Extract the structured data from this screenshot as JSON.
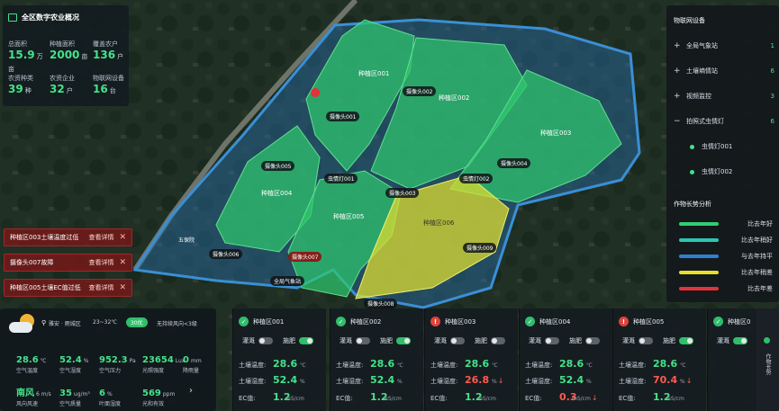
{
  "overview": {
    "title": "全区数字农业概况",
    "stats": [
      {
        "label": "总面积",
        "value": "15.9",
        "unit": "万亩"
      },
      {
        "label": "种植面积",
        "value": "2000",
        "unit": "亩"
      },
      {
        "label": "覆盖农户",
        "value": "136",
        "unit": "户"
      },
      {
        "label": "农资种类",
        "value": "39",
        "unit": "种"
      },
      {
        "label": "农资企业",
        "value": "32",
        "unit": "户"
      },
      {
        "label": "物联网设备",
        "value": "16",
        "unit": "台"
      }
    ]
  },
  "alerts": [
    {
      "text": "种植区003土壤温度过低",
      "action": "查看详情"
    },
    {
      "text": "摄像头007故障",
      "action": "查看详情"
    },
    {
      "text": "种植区005土壤EC值过低",
      "action": "查看详情"
    }
  ],
  "map": {
    "zones": [
      "种植区001",
      "种植区002",
      "种植区003",
      "种植区004",
      "种植区005",
      "种植区006"
    ],
    "devices": [
      "摄像头001",
      "摄像头002",
      "摄像头003",
      "摄像头004",
      "摄像头005",
      "摄像头006",
      "摄像头007",
      "摄像头008",
      "摄像头009",
      "虫情灯001",
      "虫情灯002",
      "全局气象站"
    ],
    "places": [
      "五保院"
    ]
  },
  "iot": {
    "title": "物联网设备",
    "items": [
      {
        "symbol": "+",
        "name": "全局气象站",
        "count": "1"
      },
      {
        "symbol": "+",
        "name": "土壤墒情站",
        "count": "6"
      },
      {
        "symbol": "+",
        "name": "视频监控",
        "count": "3"
      },
      {
        "symbol": "−",
        "name": "拍照式虫情灯",
        "count": "6"
      }
    ],
    "sub_items": [
      "虫情灯001",
      "虫情灯002"
    ]
  },
  "growth": {
    "title": "作物长势分析",
    "legend": [
      {
        "label": "比去年好",
        "color": "#2ecf72"
      },
      {
        "label": "比去年稍好",
        "color": "#2bc6b0"
      },
      {
        "label": "与去年持平",
        "color": "#2f7fd0"
      },
      {
        "label": "比去年稍差",
        "color": "#e6df2a"
      },
      {
        "label": "比去年差",
        "color": "#e2333a"
      }
    ]
  },
  "weather": {
    "location": "雅安 · 雨城区",
    "temp": "23~32℃",
    "aqi": "30优",
    "wind": "无持续风向<3级",
    "metrics": [
      {
        "value": "28.6",
        "unit": "℃",
        "label": "空气温度"
      },
      {
        "value": "52.4",
        "unit": "%",
        "label": "空气湿度"
      },
      {
        "value": "952.3",
        "unit": "Pa",
        "label": "空气压力"
      },
      {
        "value": "23654",
        "unit": "Lux",
        "label": "光照强度"
      },
      {
        "value": "0",
        "unit": "mm",
        "label": "降雨量"
      },
      {
        "value": "南风",
        "unit": "6 m/s",
        "label": "风向风速"
      },
      {
        "value": "35",
        "unit": "ug/m³",
        "label": "空气质量"
      },
      {
        "value": "6",
        "unit": "%",
        "label": "叶面湿度"
      },
      {
        "value": "569",
        "unit": "ppm",
        "label": "光和有效"
      }
    ]
  },
  "cards": [
    {
      "name": "种植区001",
      "status": "ok",
      "irrigate": "灌溉",
      "fertilize": "施肥",
      "irr_on": false,
      "fer_on": true,
      "soil_temp": "28.6",
      "soil_temp_unit": "℃",
      "soil_hum": "52.4",
      "soil_hum_unit": "%",
      "ec": "1.2",
      "ec_unit": "mS/cm",
      "temp_alert": false,
      "hum_alert": false,
      "ec_alert": false
    },
    {
      "name": "种植区002",
      "status": "ok",
      "irrigate": "灌溉",
      "fertilize": "施肥",
      "irr_on": false,
      "fer_on": true,
      "soil_temp": "28.6",
      "soil_temp_unit": "℃",
      "soil_hum": "52.4",
      "soil_hum_unit": "%",
      "ec": "1.2",
      "ec_unit": "mS/cm",
      "temp_alert": false,
      "hum_alert": false,
      "ec_alert": false
    },
    {
      "name": "种植区003",
      "status": "bad",
      "irrigate": "灌溉",
      "fertilize": "施肥",
      "irr_on": false,
      "fer_on": false,
      "soil_temp": "28.6",
      "soil_temp_unit": "℃",
      "soil_hum": "26.8",
      "soil_hum_unit": "%",
      "ec": "1.2",
      "ec_unit": "mS/cm",
      "temp_alert": false,
      "hum_alert": true,
      "ec_alert": false
    },
    {
      "name": "种植区004",
      "status": "ok",
      "irrigate": "灌溉",
      "fertilize": "施肥",
      "irr_on": false,
      "fer_on": false,
      "soil_temp": "28.6",
      "soil_temp_unit": "℃",
      "soil_hum": "52.4",
      "soil_hum_unit": "%",
      "ec": "0.3",
      "ec_unit": "mS/cm",
      "temp_alert": false,
      "hum_alert": false,
      "ec_alert": true
    },
    {
      "name": "种植区005",
      "status": "bad",
      "irrigate": "灌溉",
      "fertilize": "施肥",
      "irr_on": false,
      "fer_on": true,
      "soil_temp": "28.6",
      "soil_temp_unit": "℃",
      "soil_hum": "70.4",
      "soil_hum_unit": "%",
      "ec": "1.2",
      "ec_unit": "mS/cm",
      "temp_alert": false,
      "hum_alert": true,
      "ec_alert": false
    },
    {
      "name": "种植区0",
      "status": "ok",
      "irrigate": "灌溉",
      "fertilize": "",
      "irr_on": true,
      "fer_on": false,
      "soil_temp": "",
      "soil_temp_unit": "",
      "soil_hum": "",
      "soil_hum_unit": "",
      "ec": "",
      "ec_unit": "",
      "temp_alert": false,
      "hum_alert": false,
      "ec_alert": false
    }
  ],
  "labels": {
    "soil_temp": "土壤温度:",
    "soil_hum": "土壤湿度:",
    "ec": "EC值:"
  },
  "side_tab": "作物长势"
}
